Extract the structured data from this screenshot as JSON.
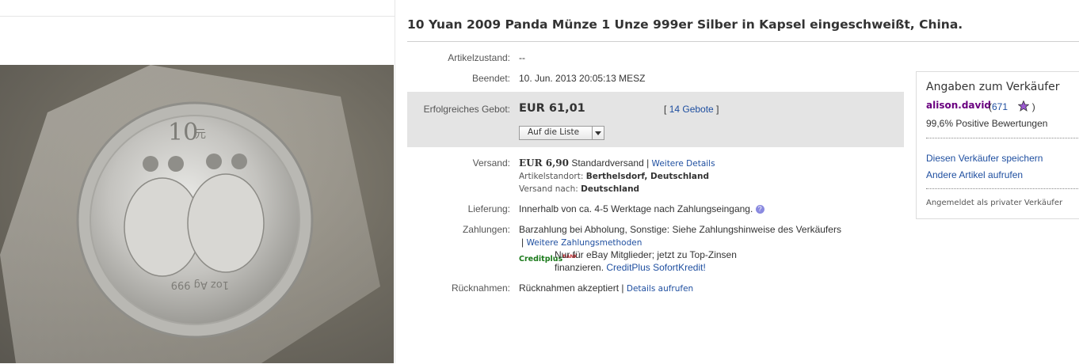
{
  "item": {
    "title": "10 Yuan 2009 Panda Münze 1 Unze 999er Silber in Kapsel eingeschweißt, China.",
    "image_alt": "Silver panda coin in sealed capsule",
    "coin_text": {
      "denomination": "10",
      "denomination_suffix": "元",
      "bottom": "1oz Ag 999"
    }
  },
  "fields": {
    "condition": {
      "label": "Artikelzustand:",
      "value": "--"
    },
    "ended": {
      "label": "Beendet:",
      "value": "10. Jun. 2013  20:05:13 MESZ"
    },
    "winning_bid": {
      "label": "Erfolgreiches Gebot:",
      "value": "EUR 61,01",
      "bids_open": "[",
      "bids_link": "14 Gebote",
      "bids_close": "]"
    },
    "watch_button": "Auf die Liste",
    "shipping": {
      "label": "Versand:",
      "price": "EUR 6,90",
      "method": "Standardversand |",
      "details_link": "Weitere Details",
      "location_label": "Artikelstandort:",
      "location_value": "Berthelsdorf, Deutschland",
      "ships_to_label": "Versand nach:",
      "ships_to_value": "Deutschland"
    },
    "delivery": {
      "label": "Lieferung:",
      "value": "Innerhalb von ca. 4-5 Werktage nach Zahlungseingang."
    },
    "payments": {
      "label": "Zahlungen:",
      "value": "Barzahlung bei Abholung,  Sonstige: Siehe Zahlungshinweise des Verkäufers",
      "pipe": "|",
      "more_link": "Weitere Zahlungsmethoden",
      "creditplus_logo": "Creditplus",
      "creditplus_logo_sup": "BANK",
      "creditplus_line1": "Nur für eBay Mitglieder; jetzt zu Top-Zinsen",
      "creditplus_line2": "finanzieren.",
      "creditplus_link": "CreditPlus SofortKredit!"
    },
    "returns": {
      "label": "Rücknahmen:",
      "value": "Rücknahmen akzeptiert",
      "pipe": "|",
      "details_link": "Details aufrufen"
    }
  },
  "seller": {
    "heading": "Angaben zum Verkäufer",
    "name": "alison.david",
    "feedback_open": "(",
    "feedback_score": "671",
    "feedback_close": ")",
    "positive": "99,6% Positive Bewertungen",
    "save_link": "Diesen Verkäufer speichern",
    "other_items_link": "Andere Artikel aufrufen",
    "registered": "Angemeldet als privater Verkäufer"
  },
  "colors": {
    "link": "#1f4fa0",
    "seller_name": "#6a0080",
    "bid_box": "#e4e4e4",
    "star": "#9b59d0"
  },
  "icons": [
    "help-icon",
    "feedback-star-icon",
    "dropdown-arrow-icon"
  ]
}
